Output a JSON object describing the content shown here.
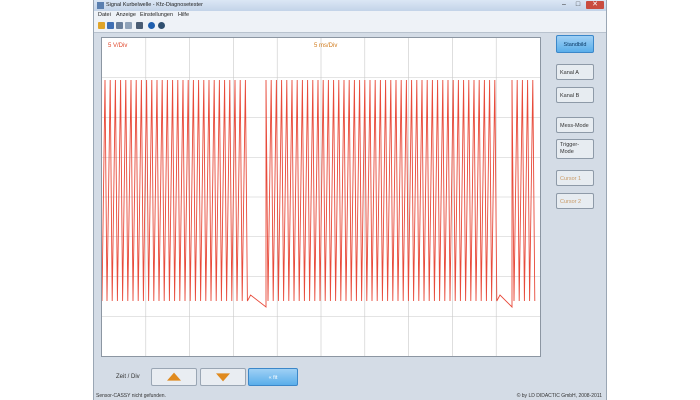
{
  "window": {
    "title": "Signal Kurbelwelle - Kfz-Diagnosetester",
    "controls": {
      "minimize": "–",
      "maximize": "□",
      "close": "✕"
    }
  },
  "menu": {
    "items": [
      "Datei",
      "Anzeige",
      "Einstellungen",
      "Hilfe"
    ]
  },
  "toolbar": {
    "icons": [
      "open-icon",
      "save-icon",
      "print-icon",
      "copy-icon",
      "settings-icon",
      "help-icon",
      "info-icon"
    ],
    "colors": [
      "#e0a52a",
      "#3f6fb3",
      "#6a7f9a",
      "#8fa2b8",
      "#4a5d74",
      "#1f5fae",
      "#2f4f6f"
    ]
  },
  "scope": {
    "volt_scale": "5 V/Div",
    "time_scale": "5 ms/Div",
    "colors": {
      "volt_label": "#e0462a",
      "time_label": "#d07a1a",
      "trace": "#e84a3a",
      "grid": "#c8c8c8"
    }
  },
  "side": {
    "buttons": [
      "Standbild",
      "Kanal A",
      "Kanal B",
      "Mess-Mode",
      "Trigger-Mode",
      "Cursor 1",
      "Cursor 2"
    ]
  },
  "bottom": {
    "zeit_label": "Zeit / Div",
    "fit_label": "« fit"
  },
  "status": {
    "left": "Sensor-CASSY nicht gefunden.",
    "right": "© by LD DIDACTIC GmbH, 2008-2011"
  }
}
